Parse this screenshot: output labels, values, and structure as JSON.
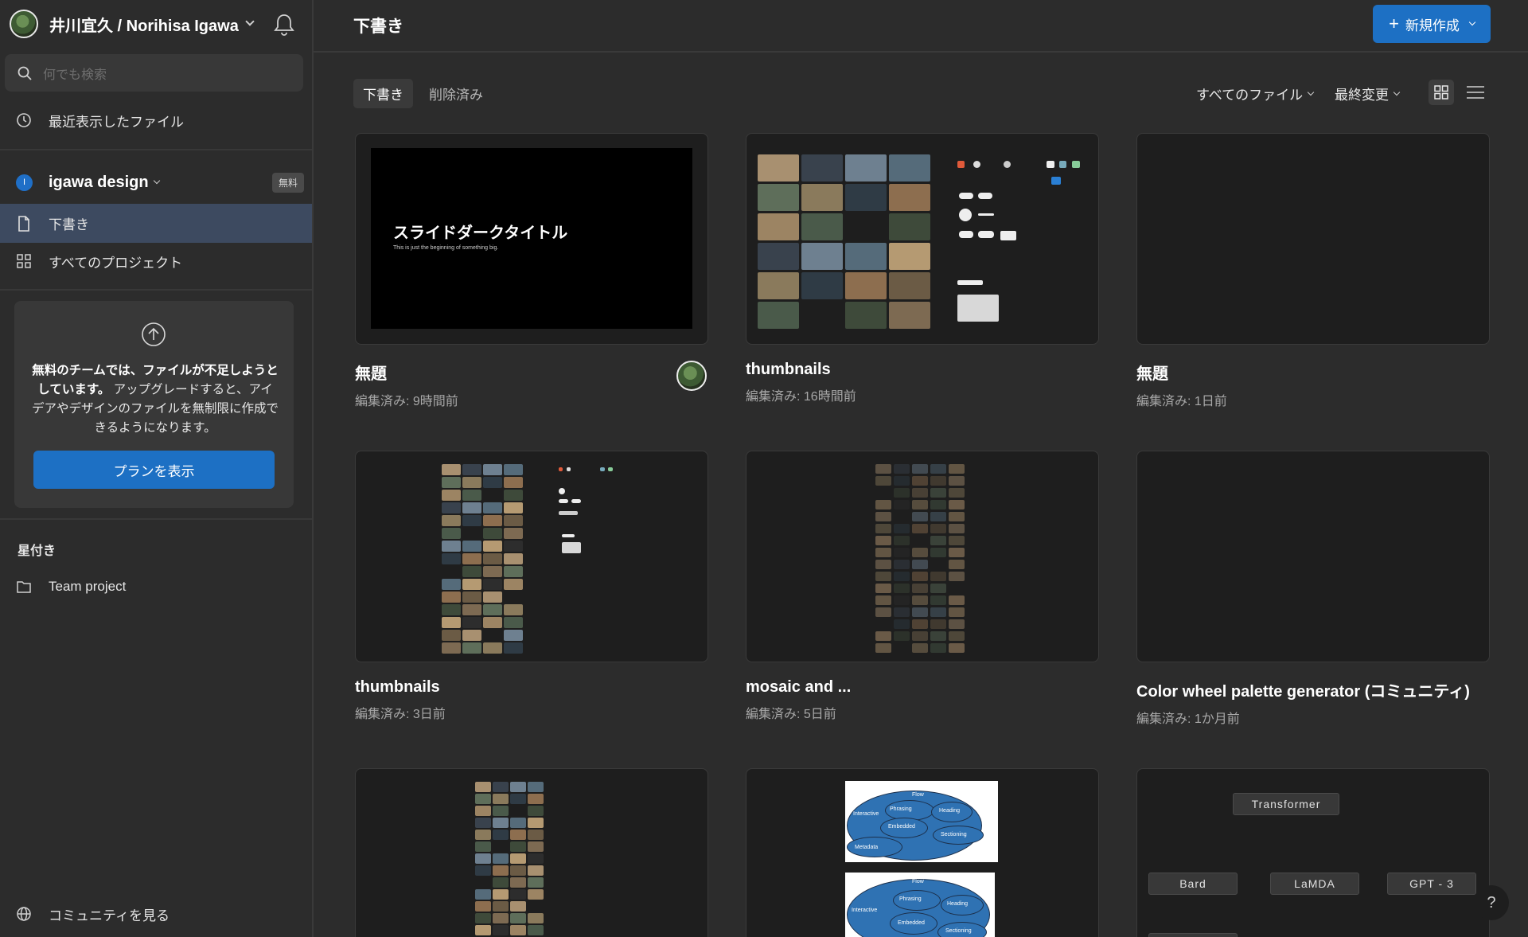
{
  "user": {
    "name": "井川宜久 / Norihisa Igawa"
  },
  "search": {
    "placeholder": "何でも検索"
  },
  "nav": {
    "recent": "最近表示したファイル"
  },
  "team": {
    "name": "igawa design",
    "initial": "I",
    "badge": "無料"
  },
  "team_nav": {
    "drafts": "下書き",
    "all_projects": "すべてのプロジェクト"
  },
  "upgrade": {
    "bold_text": "無料のチームでは、ファイルが不足しようとしています。",
    "text": "アップグレードすると、アイデアやデザインのファイルを無制限に作成できるようになります。",
    "button": "プランを表示"
  },
  "starred": {
    "heading": "星付き",
    "items": [
      "Team project"
    ]
  },
  "community": {
    "label": "コミュニティを見る"
  },
  "header": {
    "title": "下書き",
    "new_button": "新規作成"
  },
  "tabs": [
    "下書き",
    "削除済み"
  ],
  "filters": {
    "files": "すべてのファイル",
    "sort": "最終変更"
  },
  "files": [
    {
      "title": "無題",
      "edited": "編集済み: 9時間前",
      "slide_title": "スライドダークタイトル",
      "slide_sub": "This is just the beginning of something big."
    },
    {
      "title": "thumbnails",
      "edited": "編集済み: 16時間前"
    },
    {
      "title": "無題",
      "edited": "編集済み: 1日前"
    },
    {
      "title": "thumbnails",
      "edited": "編集済み: 3日前"
    },
    {
      "title": "mosaic and ...",
      "edited": "編集済み: 5日前"
    },
    {
      "title": "Color wheel palette generator (コミュニティ)",
      "edited": "編集済み: 1か月前"
    }
  ],
  "row3": {
    "diagram_labels": [
      "Flow",
      "Interactive",
      "Phrasing",
      "Heading",
      "Embedded",
      "Sectioning",
      "Metadata"
    ],
    "chips": [
      "Transformer",
      "Bard",
      "LaMDA",
      "GPT - 3"
    ]
  },
  "help": {
    "label": "?"
  }
}
